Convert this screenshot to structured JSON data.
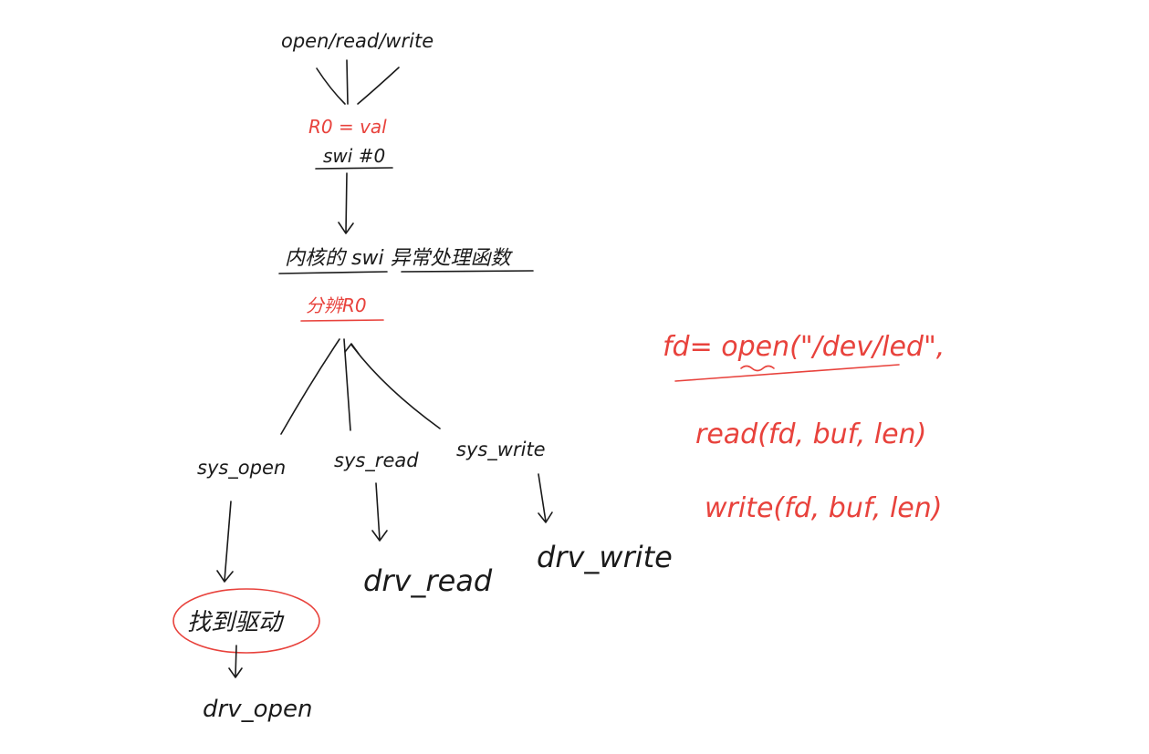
{
  "colors": {
    "ink": "#1a1a1a",
    "red_ink": "#e8423c",
    "background": "#ffffff"
  },
  "nodes": {
    "top_calls": "open/read/write",
    "r0_val": "R0 = val",
    "swi_instr": "swi #0",
    "kernel_handler": "内核的 swi 异常处理函数",
    "dispatch_r0": "分辨R0",
    "sys_open": "sys_open",
    "sys_read": "sys_read",
    "sys_write": "sys_write",
    "drv_read": "drv_read",
    "drv_write": "drv_write",
    "find_driver": "找到驱动",
    "drv_open": "drv_open"
  },
  "code": {
    "open_line": "fd= open(\"/dev/led\",",
    "read_line": "read(fd, buf, len)",
    "write_line": "write(fd, buf, len)"
  }
}
